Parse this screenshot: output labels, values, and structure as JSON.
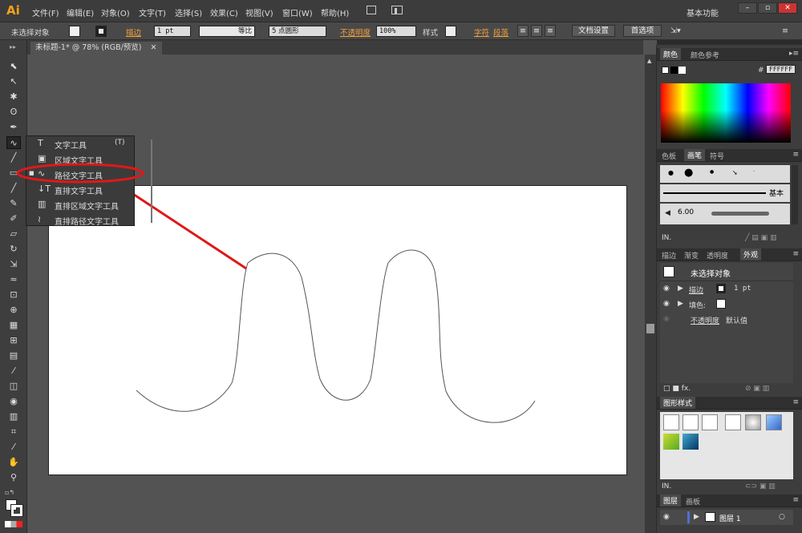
{
  "app": {
    "logo": "Ai"
  },
  "menu": [
    "文件(F)",
    "编辑(E)",
    "对象(O)",
    "文字(T)",
    "选择(S)",
    "效果(C)",
    "视图(V)",
    "窗口(W)",
    "帮助(H)"
  ],
  "workspace": "基本功能",
  "window_buttons": {
    "minimize": "–",
    "maximize": "▫",
    "close": "✕"
  },
  "control_bar": {
    "selection": "未选择对象",
    "stroke_label": "描边",
    "stroke_value": "1 pt",
    "profile": "等比",
    "brush": "5 点圆形",
    "opacity_label": "不透明度",
    "opacity_value": "100%",
    "style_label": "样式",
    "char_label": "字符",
    "para_label": "段落",
    "doc_setup": "文档设置",
    "preferences": "首选项"
  },
  "document_tab": "未标题-1* @ 78% (RGB/预览)",
  "tools": [
    "selection-tool",
    "direct-selection-tool",
    "magic-wand-tool",
    "lasso-tool",
    "pen-tool",
    "type-on-path-tool",
    "line-tool",
    "rectangle-tool",
    "paintbrush-tool",
    "pencil-tool",
    "blob-brush-tool",
    "eraser-tool",
    "rotate-tool",
    "scale-tool",
    "warp-tool",
    "free-transform-tool",
    "shape-builder-tool",
    "perspective-tool",
    "mesh-tool",
    "gradient-tool",
    "eyedropper-tool",
    "blend-tool",
    "symbol-sprayer-tool",
    "graph-tool",
    "artboard-tool",
    "slice-tool",
    "hand-tool",
    "zoom-tool"
  ],
  "flyout": {
    "items": [
      {
        "icon": "T",
        "label": "文字工具",
        "key": "(T)"
      },
      {
        "icon": "▣",
        "label": "区域文字工具",
        "key": ""
      },
      {
        "icon": "∿",
        "label": "路径文字工具",
        "key": ""
      },
      {
        "icon": "↓T",
        "label": "直排文字工具",
        "key": ""
      },
      {
        "icon": "▥",
        "label": "直排区域文字工具",
        "key": ""
      },
      {
        "icon": "≀",
        "label": "直排路径文字工具",
        "key": ""
      }
    ],
    "selected_index": 2
  },
  "annotation_color": "#e01818",
  "panels": {
    "color": {
      "tabs": [
        "颜色",
        "颜色参考"
      ],
      "hex": "FFFFFF"
    },
    "brushes": {
      "tabs": [
        "色板",
        "画笔",
        "符号"
      ],
      "basic_label": "基本",
      "size_value": "6.00"
    },
    "appearance": {
      "tabs": [
        "描边",
        "渐变",
        "透明度",
        "外观"
      ],
      "header": "未选择对象",
      "stroke_label": "描边",
      "stroke_value": "1 pt",
      "fill_label": "填色:",
      "opacity_label": "不透明度",
      "opacity_value": "默认值"
    },
    "graphic_styles": {
      "tabs": [
        "图形样式"
      ]
    },
    "layers": {
      "tabs": [
        "图层",
        "画板"
      ],
      "layer_name": "图层 1"
    }
  }
}
